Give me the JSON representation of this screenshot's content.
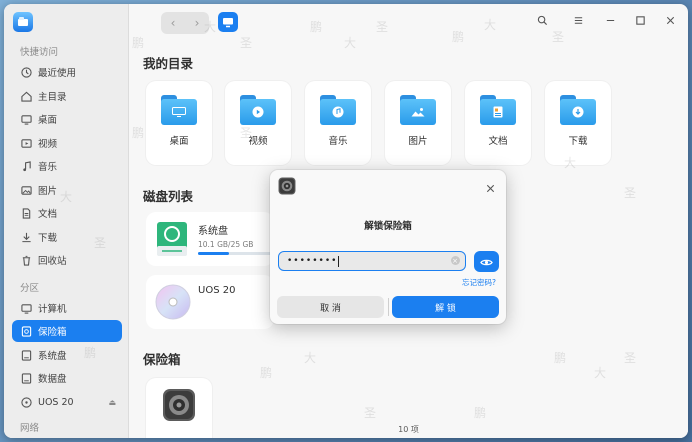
{
  "sidebar": {
    "quick_access_label": "快捷访问",
    "partition_label": "分区",
    "network_label": "网络",
    "items": [
      {
        "label": "最近使用",
        "icon": "clock-icon"
      },
      {
        "label": "主目录",
        "icon": "home-icon"
      },
      {
        "label": "桌面",
        "icon": "desktop-icon"
      },
      {
        "label": "视频",
        "icon": "video-icon"
      },
      {
        "label": "音乐",
        "icon": "music-icon"
      },
      {
        "label": "图片",
        "icon": "picture-icon"
      },
      {
        "label": "文档",
        "icon": "document-icon"
      },
      {
        "label": "下载",
        "icon": "download-icon"
      },
      {
        "label": "回收站",
        "icon": "trash-icon"
      }
    ],
    "partition_items": [
      {
        "label": "计算机",
        "icon": "computer-icon"
      },
      {
        "label": "保险箱",
        "icon": "vault-icon",
        "active": true
      },
      {
        "label": "系统盘",
        "icon": "disk-icon"
      },
      {
        "label": "数据盘",
        "icon": "disk-icon"
      },
      {
        "label": "UOS 20",
        "icon": "cdrom-icon"
      }
    ]
  },
  "main": {
    "my_dirs_title": "我的目录",
    "dirs": [
      {
        "label": "桌面",
        "icon": "desktop-folder-icon"
      },
      {
        "label": "视频",
        "icon": "video-folder-icon"
      },
      {
        "label": "音乐",
        "icon": "music-folder-icon"
      },
      {
        "label": "图片",
        "icon": "picture-folder-icon"
      },
      {
        "label": "文档",
        "icon": "document-folder-icon"
      },
      {
        "label": "下载",
        "icon": "download-folder-icon"
      }
    ],
    "disks_title": "磁盘列表",
    "disks": [
      {
        "name": "系统盘",
        "usage": "10.1 GB/25 GB",
        "used_fraction": 0.404
      },
      {
        "name": "UOS 20",
        "usage": ""
      }
    ],
    "vault_title": "保险箱",
    "status": "10 项"
  },
  "dialog": {
    "title": "解锁保险箱",
    "password_masked": "••••••••",
    "forgot": "忘记密码?",
    "cancel": "取 消",
    "unlock": "解 锁"
  },
  "colors": {
    "accent": "#1b7ff0",
    "folder": "#3aa6f0"
  }
}
